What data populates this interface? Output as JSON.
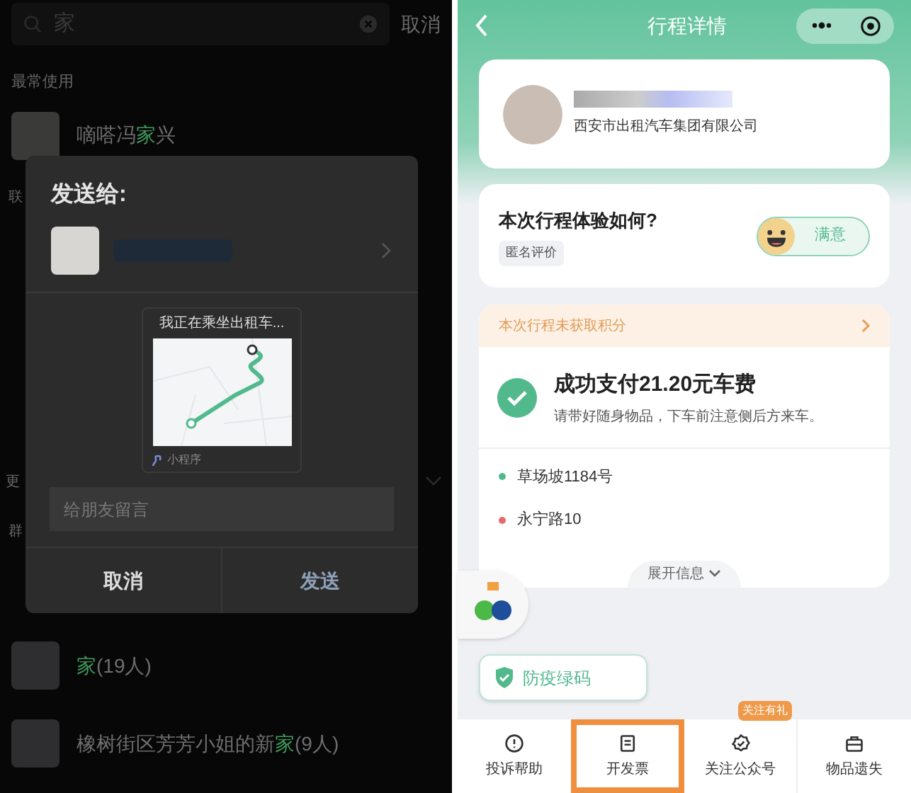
{
  "share_screen": {
    "search": {
      "value": "家",
      "cancel": "取消"
    },
    "recent_label": "最常使用",
    "recent": [
      {
        "name_parts": [
          {
            "text": "嘀嗒冯",
            "match": false
          },
          {
            "text": "家",
            "match": true
          },
          {
            "text": "兴",
            "match": false
          }
        ]
      }
    ],
    "partial_labels": [
      "联",
      "更",
      "群"
    ],
    "groups": [
      {
        "name_parts": [
          {
            "text": "家",
            "match": true
          },
          {
            "text": "(19人)",
            "match": false
          }
        ]
      },
      {
        "name_parts": [
          {
            "text": "橡树街区芳芳小姐的新",
            "match": false
          },
          {
            "text": "家",
            "match": true
          },
          {
            "text": "(9人)",
            "match": false
          }
        ]
      }
    ],
    "dialog": {
      "title": "发送给:",
      "card_title": "我正在乘坐出租车...",
      "card_source": "小程序",
      "message_placeholder": "给朋友留言",
      "cancel": "取消",
      "send": "发送"
    }
  },
  "trip_screen": {
    "title": "行程详情",
    "driver": {
      "company": "西安市出租汽车集团有限公司"
    },
    "rating": {
      "question": "本次行程体验如何?",
      "tag": "匿名评价",
      "button": "满意"
    },
    "points_notice": "本次行程未获取积分",
    "payment": {
      "title": "成功支付21.20元车费",
      "subtitle": "请带好随身物品，下车前注意侧后方来车。"
    },
    "stops": [
      {
        "name": "草场坡1184号",
        "color": "#52b98d"
      },
      {
        "name": "永宁路10",
        "color": "#e86a6a"
      }
    ],
    "expand": "展开信息",
    "health_code": "防疫绿码",
    "bottom_bar": [
      {
        "label": "投诉帮助",
        "highlighted": false
      },
      {
        "label": "开发票",
        "highlighted": true
      },
      {
        "label": "关注公众号",
        "highlighted": false,
        "badge": "关注有礼"
      },
      {
        "label": "物品遗失",
        "highlighted": false
      }
    ]
  }
}
